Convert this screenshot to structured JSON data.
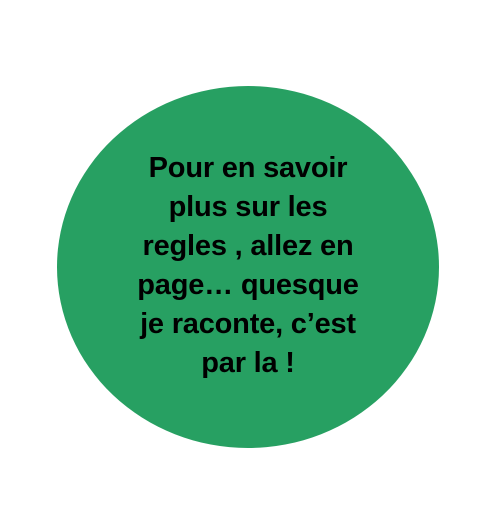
{
  "badge": {
    "color": "#27a062",
    "lines": [
      "Pour en savoir",
      "plus sur les",
      "regles , allez en",
      "page… quesque",
      "je raconte, c’est",
      "par la !"
    ]
  }
}
